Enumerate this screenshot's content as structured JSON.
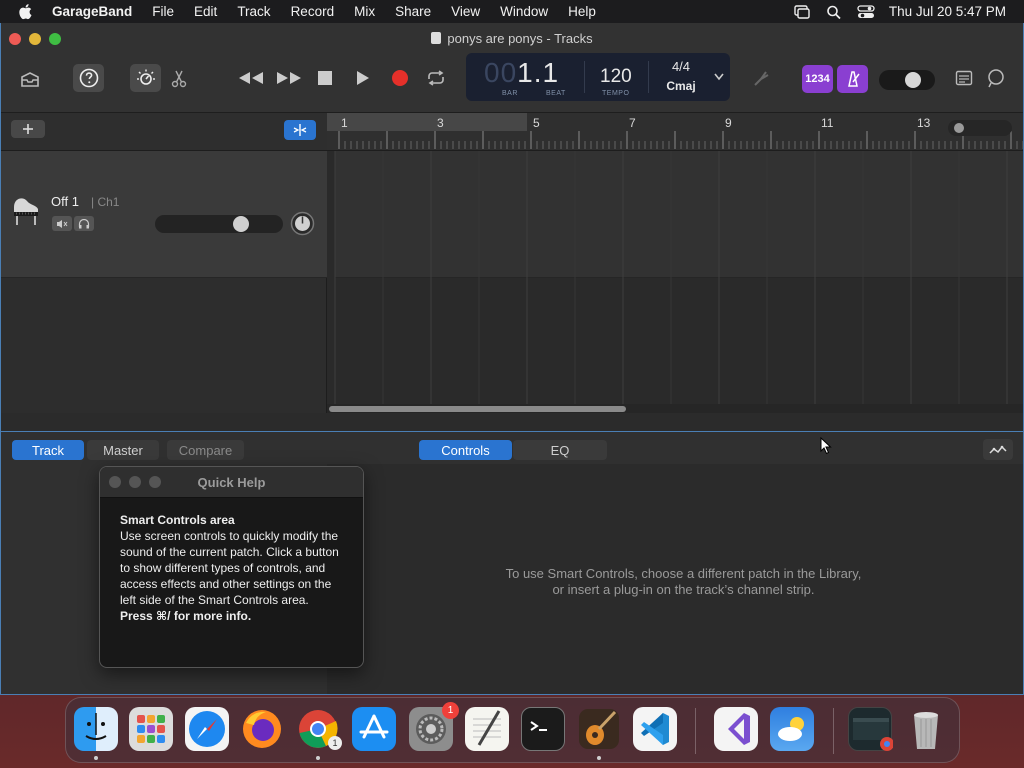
{
  "menubar": {
    "app_name": "GarageBand",
    "items": [
      "File",
      "Edit",
      "Track",
      "Record",
      "Mix",
      "Share",
      "View",
      "Window",
      "Help"
    ],
    "clock": "Thu Jul 20  5:47 PM"
  },
  "window": {
    "title": "ponys are ponys - Tracks"
  },
  "lcd": {
    "bar_dim": "00",
    "bar_value": "1.1",
    "bar_label": "BAR",
    "beat_label": "BEAT",
    "tempo": "120",
    "tempo_label": "TEMPO",
    "time_signature": "4/4",
    "key": "Cmaj"
  },
  "toolbar": {
    "count_in_label": "1234"
  },
  "ruler": {
    "bars": [
      "1",
      "3",
      "5",
      "7",
      "9",
      "11",
      "13"
    ]
  },
  "track": {
    "name": "Off 1",
    "channel": "| Ch1",
    "volume": 0.7
  },
  "smart_controls": {
    "tabs_left": [
      "Track",
      "Master",
      "Compare"
    ],
    "active_left": "Track",
    "tabs_center": [
      "Controls",
      "EQ"
    ],
    "active_center": "Controls",
    "message_line1": "To use Smart Controls, choose a different patch in the Library,",
    "message_line2": "or insert a plug-in on the track’s channel strip."
  },
  "quick_help": {
    "title": "Quick Help",
    "heading": "Smart Controls area",
    "body": "Use screen controls to quickly modify the sound of the current patch. Click a button to show different types of controls, and access effects and other settings on the left side of the Smart Controls area.",
    "footer": "Press ⌘/ for more info."
  },
  "dock": {
    "apps": [
      "finder-icon",
      "launchpad-icon",
      "safari-icon",
      "firefox-icon",
      "chrome-icon",
      "app-store-icon",
      "system-settings-icon",
      "textedit-icon",
      "terminal-icon",
      "garageband-icon",
      "vscode-icon",
      "visual-studio-icon",
      "weather-icon",
      "chrome-window-icon",
      "trash-icon"
    ],
    "settings_badge": "1",
    "chrome_badge": "1"
  },
  "colors": {
    "accent": "#2a74d0",
    "record": "#e5302a",
    "purple": "#8a3fd1"
  }
}
